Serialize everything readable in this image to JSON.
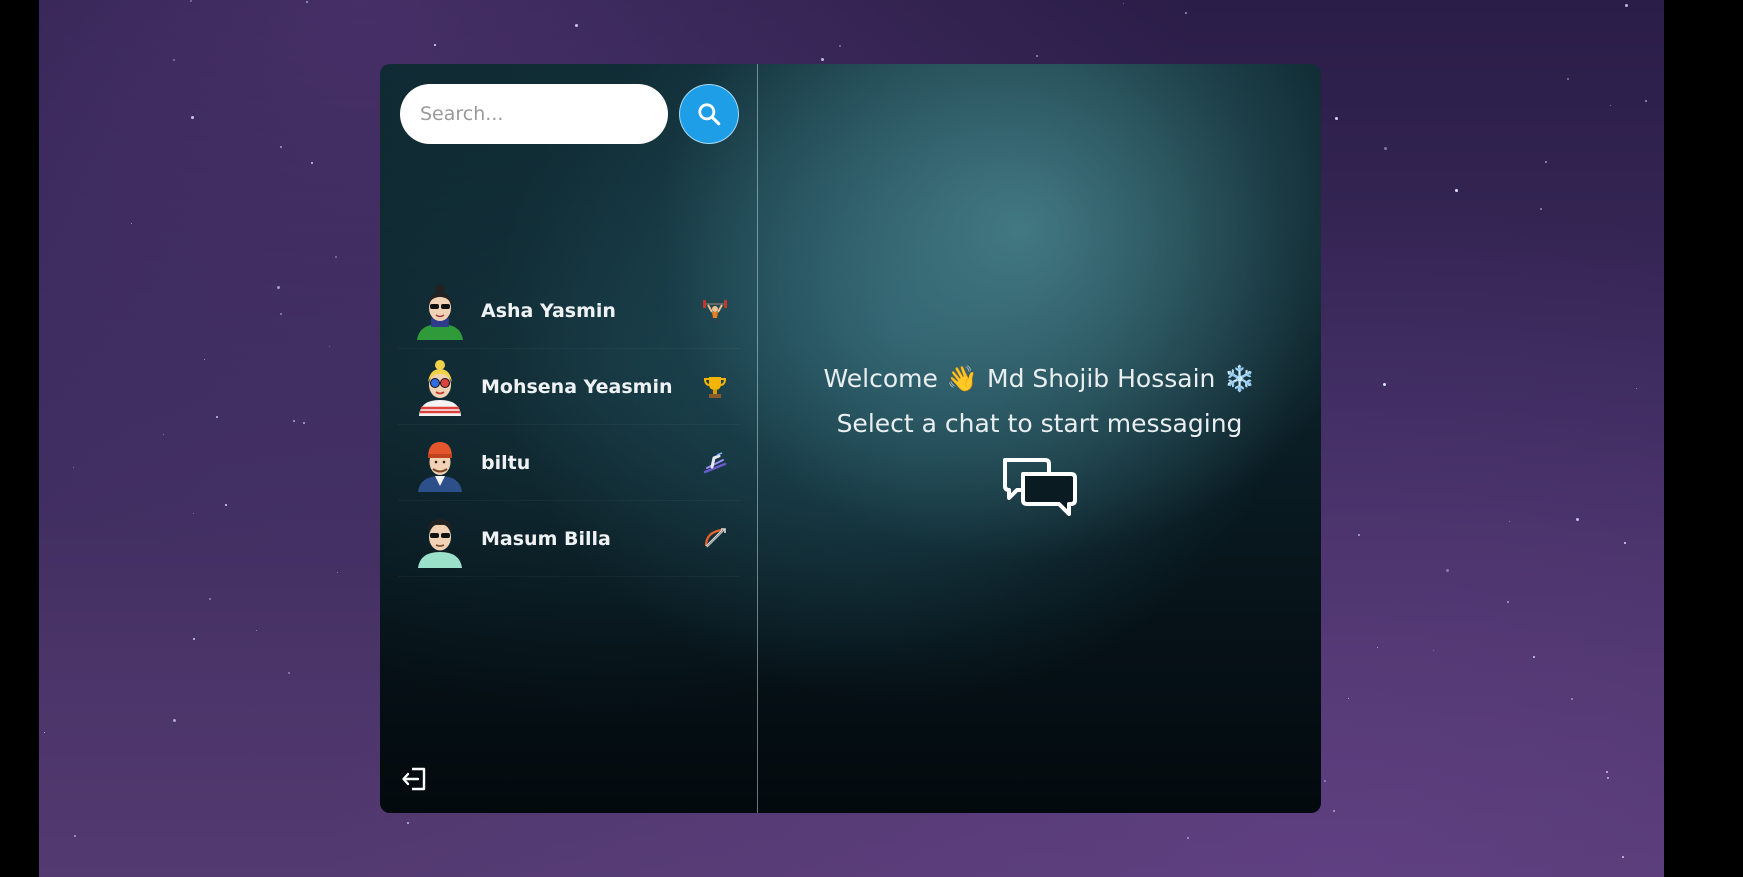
{
  "search": {
    "placeholder": "Search..."
  },
  "contacts": [
    {
      "name": "Asha Yasmin",
      "avatar": "avatar-woman-bun-sunglasses",
      "emoji": "weightlifter-emoji"
    },
    {
      "name": "Mohsena Yeasmin",
      "avatar": "avatar-woman-blonde-glasses",
      "emoji": "trophy-emoji"
    },
    {
      "name": "biltu",
      "avatar": "avatar-man-red-beanie",
      "emoji": "ski-emoji"
    },
    {
      "name": "Masum Billa",
      "avatar": "avatar-man-sunglasses",
      "emoji": "bow-and-arrow-emoji"
    }
  ],
  "welcome": {
    "prefix": "Welcome",
    "wave": "👋",
    "user_name": "Md Shojib Hossain",
    "snow": "❄️",
    "subtitle": "Select a chat to start messaging"
  },
  "icons": {
    "search": "search-icon",
    "logout": "logout-icon",
    "chat": "chat-bubbles-icon"
  },
  "colors": {
    "accent": "#1e9ee6",
    "text": "#eef2f4"
  }
}
